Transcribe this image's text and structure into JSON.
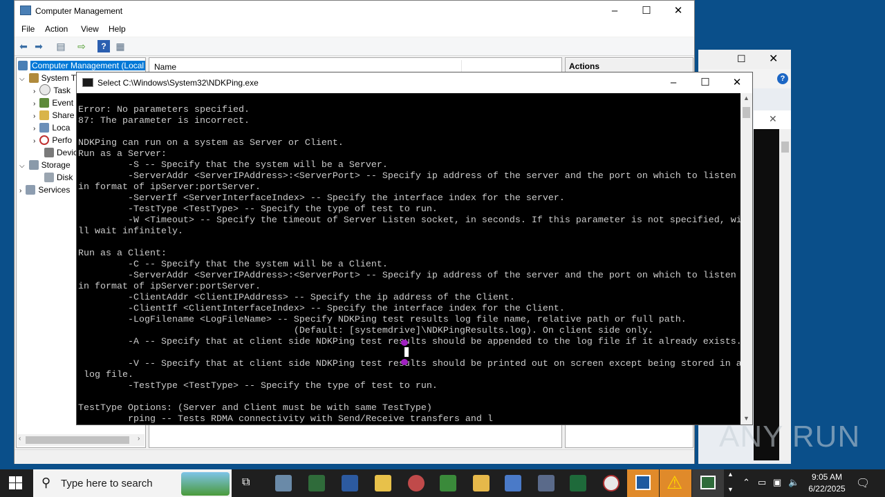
{
  "computer_management": {
    "title": "Computer Management",
    "menu": [
      "File",
      "Action",
      "View",
      "Help"
    ],
    "tree": {
      "root": "Computer Management (Local",
      "system_tools": "System T",
      "task_scheduler": "Task",
      "event_viewer": "Event",
      "shared_folders": "Share",
      "local_users": "Loca",
      "performance": "Perfo",
      "device_manager": "Devic",
      "storage": "Storage",
      "disk_management": "Disk",
      "services": "Services"
    },
    "middle": {
      "column_name": "Name"
    },
    "actions": {
      "header": "Actions"
    }
  },
  "console": {
    "title": "Select C:\\Windows\\System32\\NDKPing.exe",
    "lines": [
      "Error: No parameters specified.",
      "87: The parameter is incorrect.",
      "",
      "NDKPing can run on a system as Server or Client.",
      "Run as a Server:",
      "         -S -- Specify that the system will be a Server.",
      "         -ServerAddr <ServerIPAddress>:<ServerPort> -- Specify ip address of the server and the port on which to listen",
      "in format of ipServer:portServer.",
      "         -ServerIf <ServerInterfaceIndex> -- Specify the interface index for the server.",
      "         -TestType <TestType> -- Specify the type of test to run.",
      "         -W <Timeout> -- Specify the timeout of Server Listen socket, in seconds. If this parameter is not specified, wi",
      "ll wait infinitely.",
      "",
      "Run as a Client:",
      "         -C -- Specify that the system will be a Client.",
      "         -ServerAddr <ServerIPAddress>:<ServerPort> -- Specify ip address of the server and the port on which to listen",
      "in format of ipServer:portServer.",
      "         -ClientAddr <ClientIPAddress> -- Specify the ip address of the Client.",
      "         -ClientIf <ClientInterfaceIndex> -- Specify the interface index for the Client.",
      "         -LogFilename <LogFileName> -- Specify NDKPing test results log file name, relative path or full path.",
      "                                       (Default: [systemdrive]\\NDKPingResults.log). On client side only.",
      "         -A -- Specify that at client side NDKPing test results should be appended to the log file if it already exists.",
      "",
      "         -V -- Specify that at client side NDKPing test results should be printed out on screen except being stored in a",
      " log file.",
      "         -TestType <TestType> -- Specify the type of test to run.",
      "",
      "TestType Options: (Server and Client must be with same TestType)",
      "         rping -- Tests RDMA connectivity with Send/Receive transfers and l"
    ]
  },
  "watermark": "ANY RUN",
  "taskbar": {
    "search_placeholder": "Type here to search",
    "time": "9:05 AM",
    "date": "6/22/2025"
  },
  "colors": {
    "desktop": "#0a4f8a",
    "selection": "#0078d7",
    "taskbar": "#1f1f1f",
    "console_bg": "#000000",
    "console_text": "#cccccc"
  }
}
